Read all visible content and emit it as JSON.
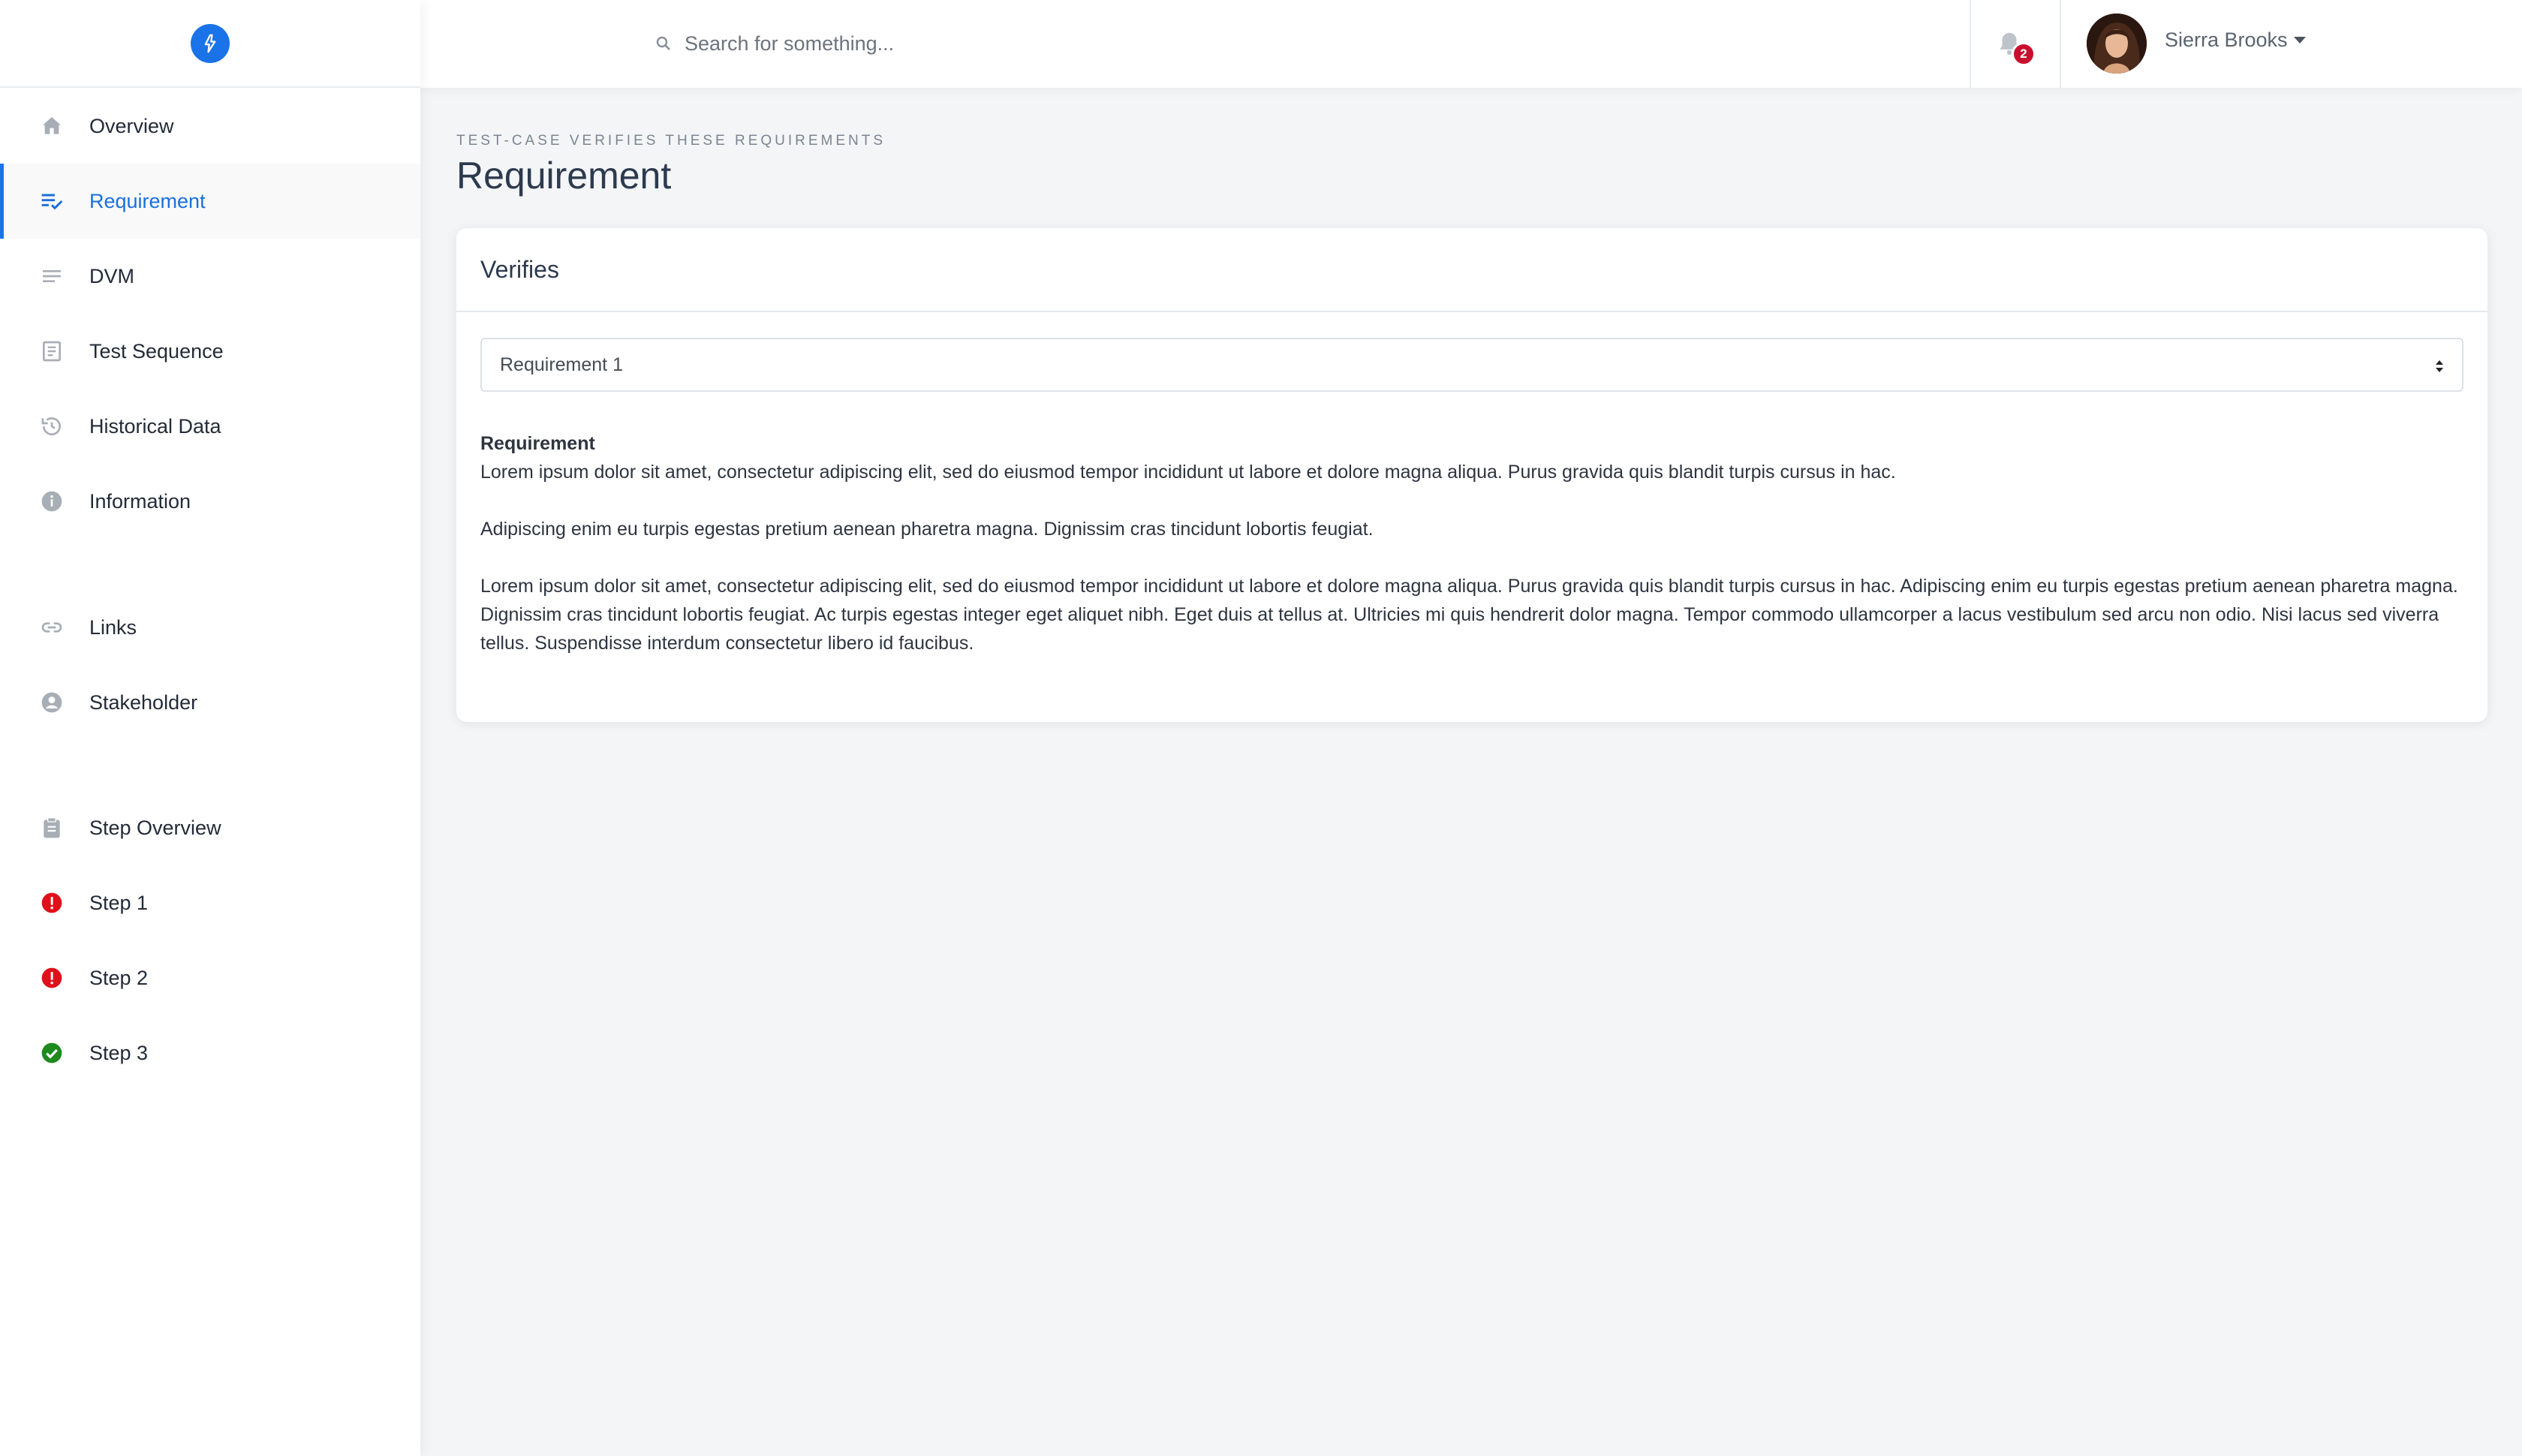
{
  "sidebar": {
    "items": [
      {
        "label": "Overview",
        "icon": "home-icon",
        "active": false
      },
      {
        "label": "Requirement",
        "icon": "list-check-icon",
        "active": true
      },
      {
        "label": "DVM",
        "icon": "lines-icon",
        "active": false
      },
      {
        "label": "Test Sequence",
        "icon": "document-icon",
        "active": false
      },
      {
        "label": "Historical Data",
        "icon": "history-icon",
        "active": false
      },
      {
        "label": "Information",
        "icon": "info-icon",
        "active": false
      },
      {
        "label": "Links",
        "icon": "link-icon",
        "active": false
      },
      {
        "label": "Stakeholder",
        "icon": "user-circle-icon",
        "active": false
      },
      {
        "label": "Step Overview",
        "icon": "clipboard-icon",
        "active": false
      },
      {
        "label": "Step 1",
        "icon": "error-icon",
        "active": false
      },
      {
        "label": "Step 2",
        "icon": "error-icon",
        "active": false
      },
      {
        "label": "Step 3",
        "icon": "check-circle-icon",
        "active": false
      }
    ]
  },
  "header": {
    "search_placeholder": "Search for something...",
    "notification_count": "2",
    "user_name": "Sierra Brooks"
  },
  "main": {
    "pretitle": "TEST-CASE VERIFIES THESE REQUIREMENTS",
    "title": "Requirement",
    "card": {
      "title": "Verifies",
      "select_value": "Requirement 1",
      "content_label": "Requirement",
      "paragraphs": [
        "Lorem ipsum dolor sit amet, consectetur adipiscing elit, sed do eiusmod tempor incididunt ut labore et dolore magna aliqua. Purus gravida quis blandit turpis cursus in hac.",
        "Adipiscing enim eu turpis egestas pretium aenean pharetra magna. Dignissim cras tincidunt lobortis feugiat.",
        "Lorem ipsum dolor sit amet, consectetur adipiscing elit, sed do eiusmod tempor incididunt ut labore et dolore magna aliqua. Purus gravida quis blandit turpis cursus in hac. Adipiscing enim eu turpis egestas pretium aenean pharetra magna. Dignissim cras tincidunt lobortis feugiat. Ac turpis egestas integer eget aliquet nibh. Eget duis at tellus at. Ultricies mi quis hendrerit dolor magna. Tempor commodo ullamcorper a lacus vestibulum sed arcu non odio. Nisi lacus sed viverra tellus. Suspendisse interdum consectetur libero id faucibus."
      ]
    }
  },
  "colors": {
    "accent": "#1a73e8",
    "error": "#e0101a",
    "success": "#1e8a1e",
    "badge": "#c8102e"
  }
}
